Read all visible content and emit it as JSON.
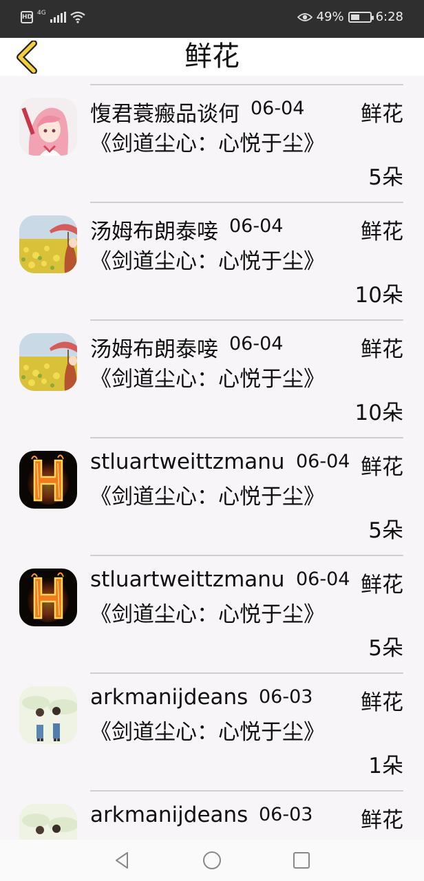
{
  "status_bar": {
    "hd": "HD",
    "network": "4G",
    "battery_percent": "49%",
    "time": "6:28",
    "battery_level": 0.49
  },
  "header": {
    "title": "鲜花",
    "back_icon": "chevron-left-icon"
  },
  "items": [
    {
      "name": "愎君蓑瘢品谈何",
      "date": "06-04",
      "gift": "鲜花",
      "book": "《剑道尘心：心悦于尘》",
      "count": "5朵",
      "avatar": "anime-girl"
    },
    {
      "name": "汤姆布朗泰唼",
      "date": "06-04",
      "gift": "鲜花",
      "book": "《剑道尘心：心悦于尘》",
      "count": "10朵",
      "avatar": "flower-field"
    },
    {
      "name": "汤姆布朗泰唼",
      "date": "06-04",
      "gift": "鲜花",
      "book": "《剑道尘心：心悦于尘》",
      "count": "10朵",
      "avatar": "flower-field"
    },
    {
      "name": "stluartweittzmanu",
      "date": "06-04",
      "gift": "鲜花",
      "book": "《剑道尘心：心悦于尘》",
      "count": "5朵",
      "avatar": "fire-letter-h"
    },
    {
      "name": "stluartweittzmanu",
      "date": "06-04",
      "gift": "鲜花",
      "book": "《剑道尘心：心悦于尘》",
      "count": "5朵",
      "avatar": "fire-letter-h"
    },
    {
      "name": "arkmanijdeans",
      "date": "06-03",
      "gift": "鲜花",
      "book": "《剑道尘心：心悦于尘》",
      "count": "1朵",
      "avatar": "couple-illustration"
    },
    {
      "name": "arkmanijdeans",
      "date": "06-03",
      "gift": "鲜花",
      "book": "",
      "count": "",
      "avatar": "couple-illustration"
    }
  ],
  "nav": {
    "back": "triangle-back-icon",
    "home": "circle-home-icon",
    "recents": "square-recents-icon"
  },
  "colors": {
    "back_arrow": "#f2cf3c",
    "status_bar_bg": "#2f2f2f",
    "list_bg": "#f7f5f7"
  }
}
